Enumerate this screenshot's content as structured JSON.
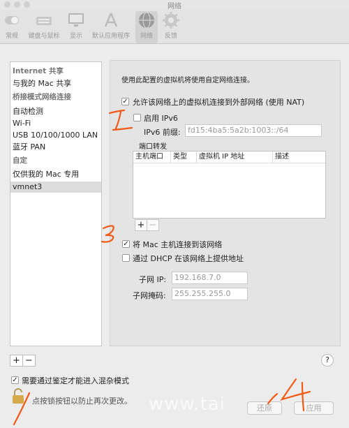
{
  "window": {
    "title": "网络"
  },
  "toolbar": {
    "items": [
      {
        "label": "常规"
      },
      {
        "label": "键盘与鼠标"
      },
      {
        "label": "显示"
      },
      {
        "label": "默认应用程序"
      },
      {
        "label": "网络"
      },
      {
        "label": "反馈"
      }
    ]
  },
  "sidebar": {
    "header_internet": "Internet 共享",
    "share_mac": "与我的 Mac 共享",
    "header_bridge": "桥接模式网络连接",
    "auto_detect": "自动检测",
    "wifi": "Wi-Fi",
    "usb_lan": "USB 10/100/1000 LAN",
    "bluetooth": "蓝牙 PAN",
    "header_custom": "自定",
    "mac_only": "仅供我的 Mac 专用",
    "vmnet3": "vmnet3",
    "add_label": "+",
    "remove_label": "−"
  },
  "panel": {
    "intro": "使用此配置的虚拟机将使用自定网络连接。",
    "nat_label": "允许该网络上的虚拟机连接到外部网络 (使用 NAT)",
    "nat_checked": true,
    "ipv6_label": "启用 IPv6",
    "ipv6_checked": false,
    "ipv6_prefix_label": "IPv6 前缀:",
    "ipv6_prefix_value": "fd15:4ba5:5a2b:1003::/64",
    "port_forward_title": "端口转发",
    "port_columns": [
      "主机端口",
      "类型",
      "虚拟机 IP 地址",
      "描述"
    ],
    "port_add": "+",
    "port_remove": "−",
    "connect_mac_label": "将 Mac 主机连接到该网络",
    "connect_mac_checked": true,
    "dhcp_label": "通过 DHCP 在该网络上提供地址",
    "dhcp_checked": false,
    "subnet_ip_label": "子网 IP:",
    "subnet_ip_value": "192.168.7.0",
    "subnet_mask_label": "子网掩码:",
    "subnet_mask_value": "255.255.255.0"
  },
  "footer": {
    "auth_label": "需要通过鉴定才能进入混杂模式",
    "auth_checked": true,
    "lock_text": "点按锁按钮以防止再次更改。",
    "help_label": "?",
    "revert_label": "还原",
    "apply_label": "应用"
  },
  "watermark": "www.tai",
  "annotations": [
    "1",
    "3",
    "4"
  ],
  "colors": {
    "annotation": "#f05a14"
  }
}
